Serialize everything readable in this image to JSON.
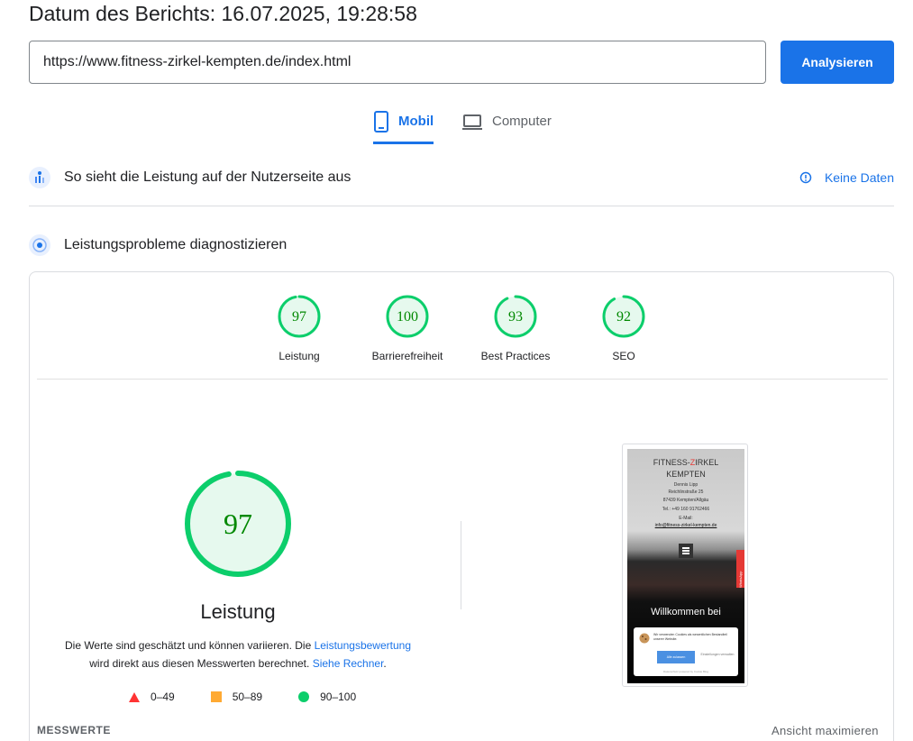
{
  "report": {
    "date_label": "Datum des Berichts: 16.07.2025, 19:28:58"
  },
  "url_bar": {
    "value": "https://www.fitness-zirkel-kempten.de/index.html"
  },
  "analyze_button": {
    "label": "Analysieren"
  },
  "device_tabs": [
    {
      "label": "Mobil",
      "icon": "smartphone-icon",
      "selected": true
    },
    {
      "label": "Computer",
      "icon": "laptop-icon",
      "selected": false
    }
  ],
  "field_data": {
    "title": "So sieht die Leistung auf der Nutzerseite aus",
    "status": "Keine Daten",
    "status_icon": "info-icon"
  },
  "diagnostics": {
    "title": "Leistungsprobleme diagnostizieren"
  },
  "scores": [
    {
      "value": 97,
      "label": "Leistung"
    },
    {
      "value": 100,
      "label": "Barrierefreiheit"
    },
    {
      "value": 93,
      "label": "Best Practices"
    },
    {
      "value": 92,
      "label": "SEO"
    }
  ],
  "performance": {
    "score": 97,
    "label": "Leistung",
    "desc_part1": "Die Werte sind geschätzt und können variieren. Die ",
    "desc_link1": "Leistungsbewertung",
    "desc_part2": "wird direkt aus diesen Messwerten berechnet. ",
    "desc_link2": "Siehe Rechner",
    "desc_part3": "."
  },
  "legend": [
    {
      "range": "0–49",
      "color": "#ff3333",
      "shape": "triangle"
    },
    {
      "range": "50–89",
      "color": "#ffaa33",
      "shape": "square"
    },
    {
      "range": "90–100",
      "color": "#0cce6b",
      "shape": "circle"
    }
  ],
  "screenshot": {
    "brand_part1": "FITNESS-",
    "brand_accent": "Z",
    "brand_part2": "IRKEL",
    "brand_line2": "KEMPTEN",
    "name": "Dennis Lipp",
    "street": "Reichlinstraße 25",
    "city": "87439 Kempten/Allgäu",
    "phone": "Tel.: +49 160 91762466",
    "email_label": "E-Mail:",
    "email": "info@fitness-zirkel-kempten.de",
    "side_tab": "WhatsApp",
    "welcome": "Willkommen bei",
    "cookie_text": "Wir verwenden Cookies als wesentlichen Bestandteil unserer Website.",
    "cookie_accept": "Alle zulassen",
    "cookie_settings": "Einstellungen verwalten",
    "cookie_footer": "Datenschutz powered by Cookie Blog"
  },
  "colors": {
    "accent": "#1a73e8",
    "good": "#0cce6b",
    "good_bg": "#e6f9ee",
    "score_text": "#008800"
  },
  "metrics": {
    "heading": "MESSWERTE",
    "expand_label": "Ansicht maximieren"
  }
}
